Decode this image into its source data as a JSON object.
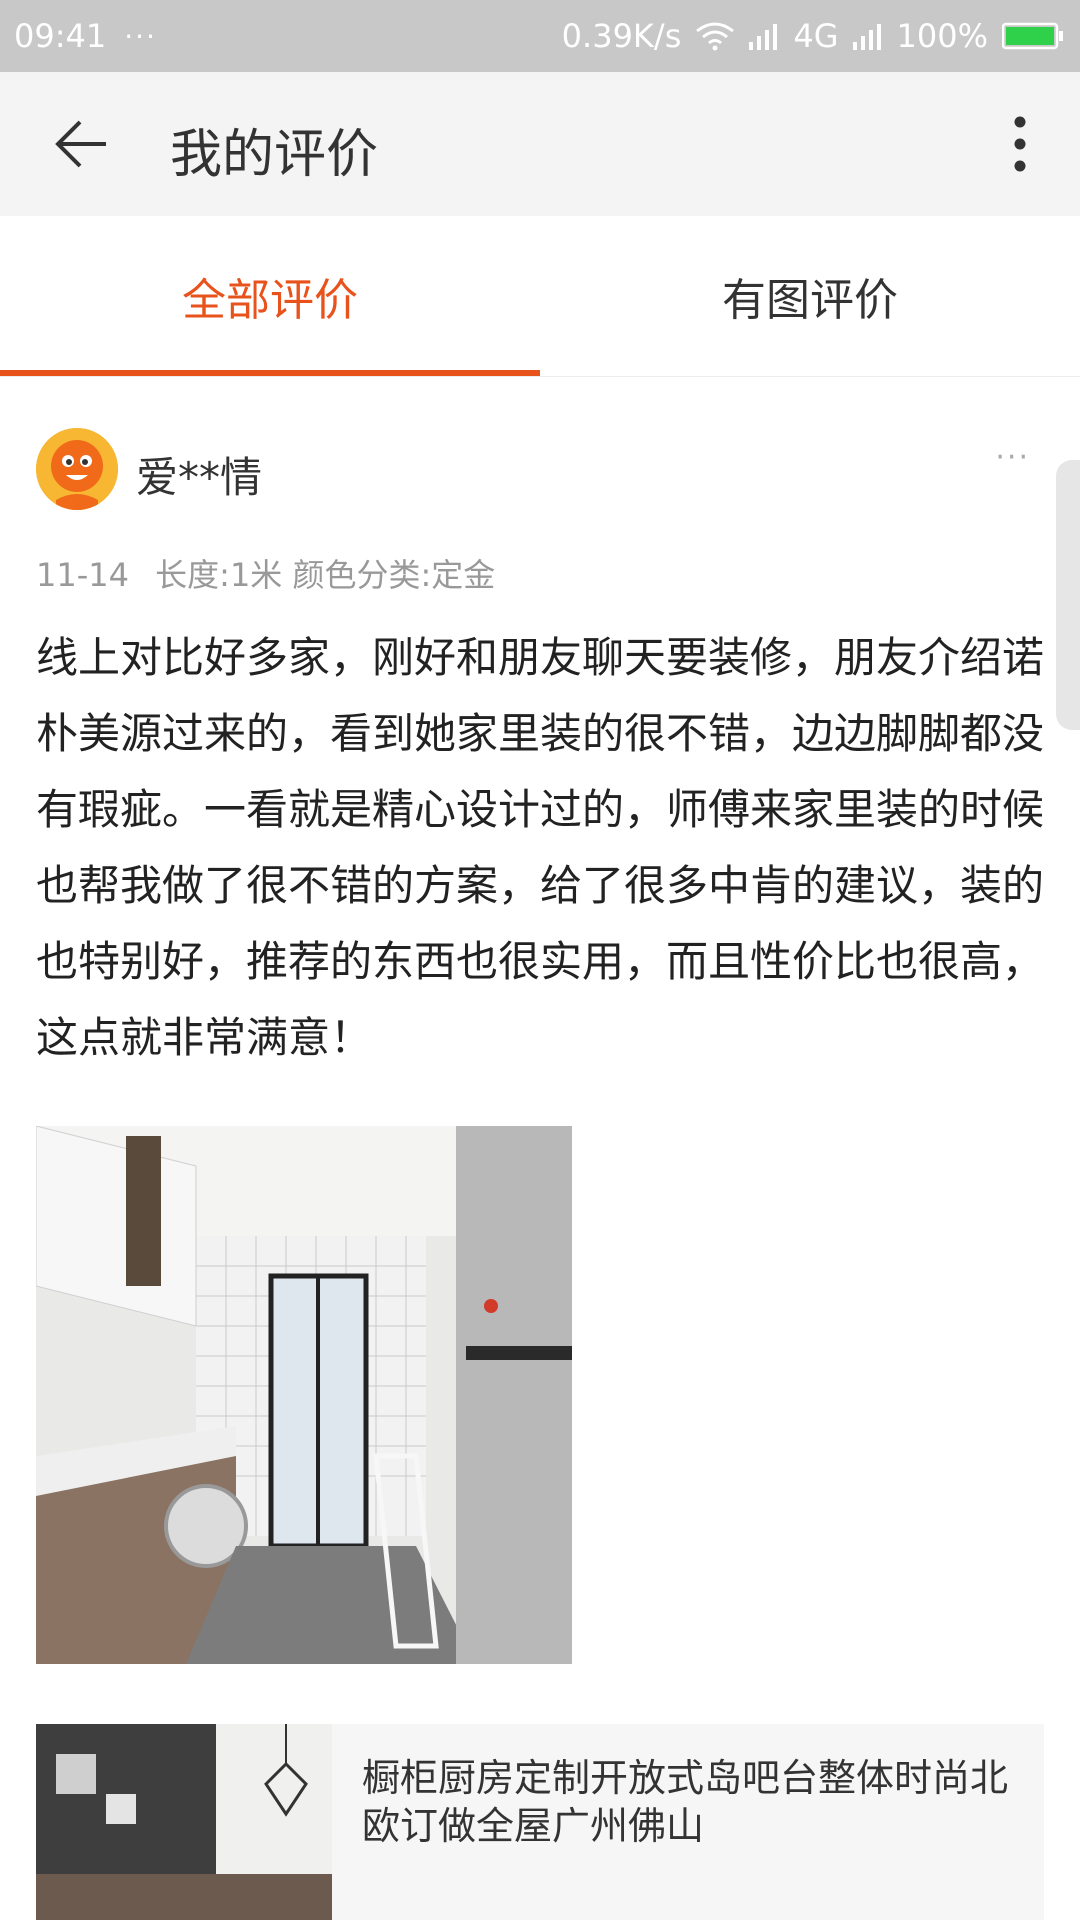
{
  "status_bar": {
    "time": "09:41",
    "notification_dots": "···",
    "net_speed": "0.39K/s",
    "network": "4G",
    "battery": "100%"
  },
  "app_bar": {
    "title": "我的评价",
    "back_icon": "back-arrow-icon",
    "more_icon": "more-vertical-icon"
  },
  "tabs": [
    {
      "label": "全部评价",
      "active": true
    },
    {
      "label": "有图评价",
      "active": false
    }
  ],
  "accent_color": "#e8531c",
  "review": {
    "user_name": "爱**情",
    "more_label": "···",
    "date": "11-14",
    "spec": "长度:1米 颜色分类:定金",
    "text": "线上对比好多家，刚好和朋友聊天要装修，朋友介绍诺朴美源过来的，看到她家里装的很不错，边边脚脚都没有瑕疵。一看就是精心设计过的，师傅来家里装的时候也帮我做了很不错的方案，给了很多中肯的建议，装的也特别好，推荐的东西也很实用，而且性价比也很高，这点就非常满意！"
  },
  "product": {
    "title": "橱柜厨房定制开放式岛吧台整体时尚北欧订做全屋广州佛山"
  }
}
